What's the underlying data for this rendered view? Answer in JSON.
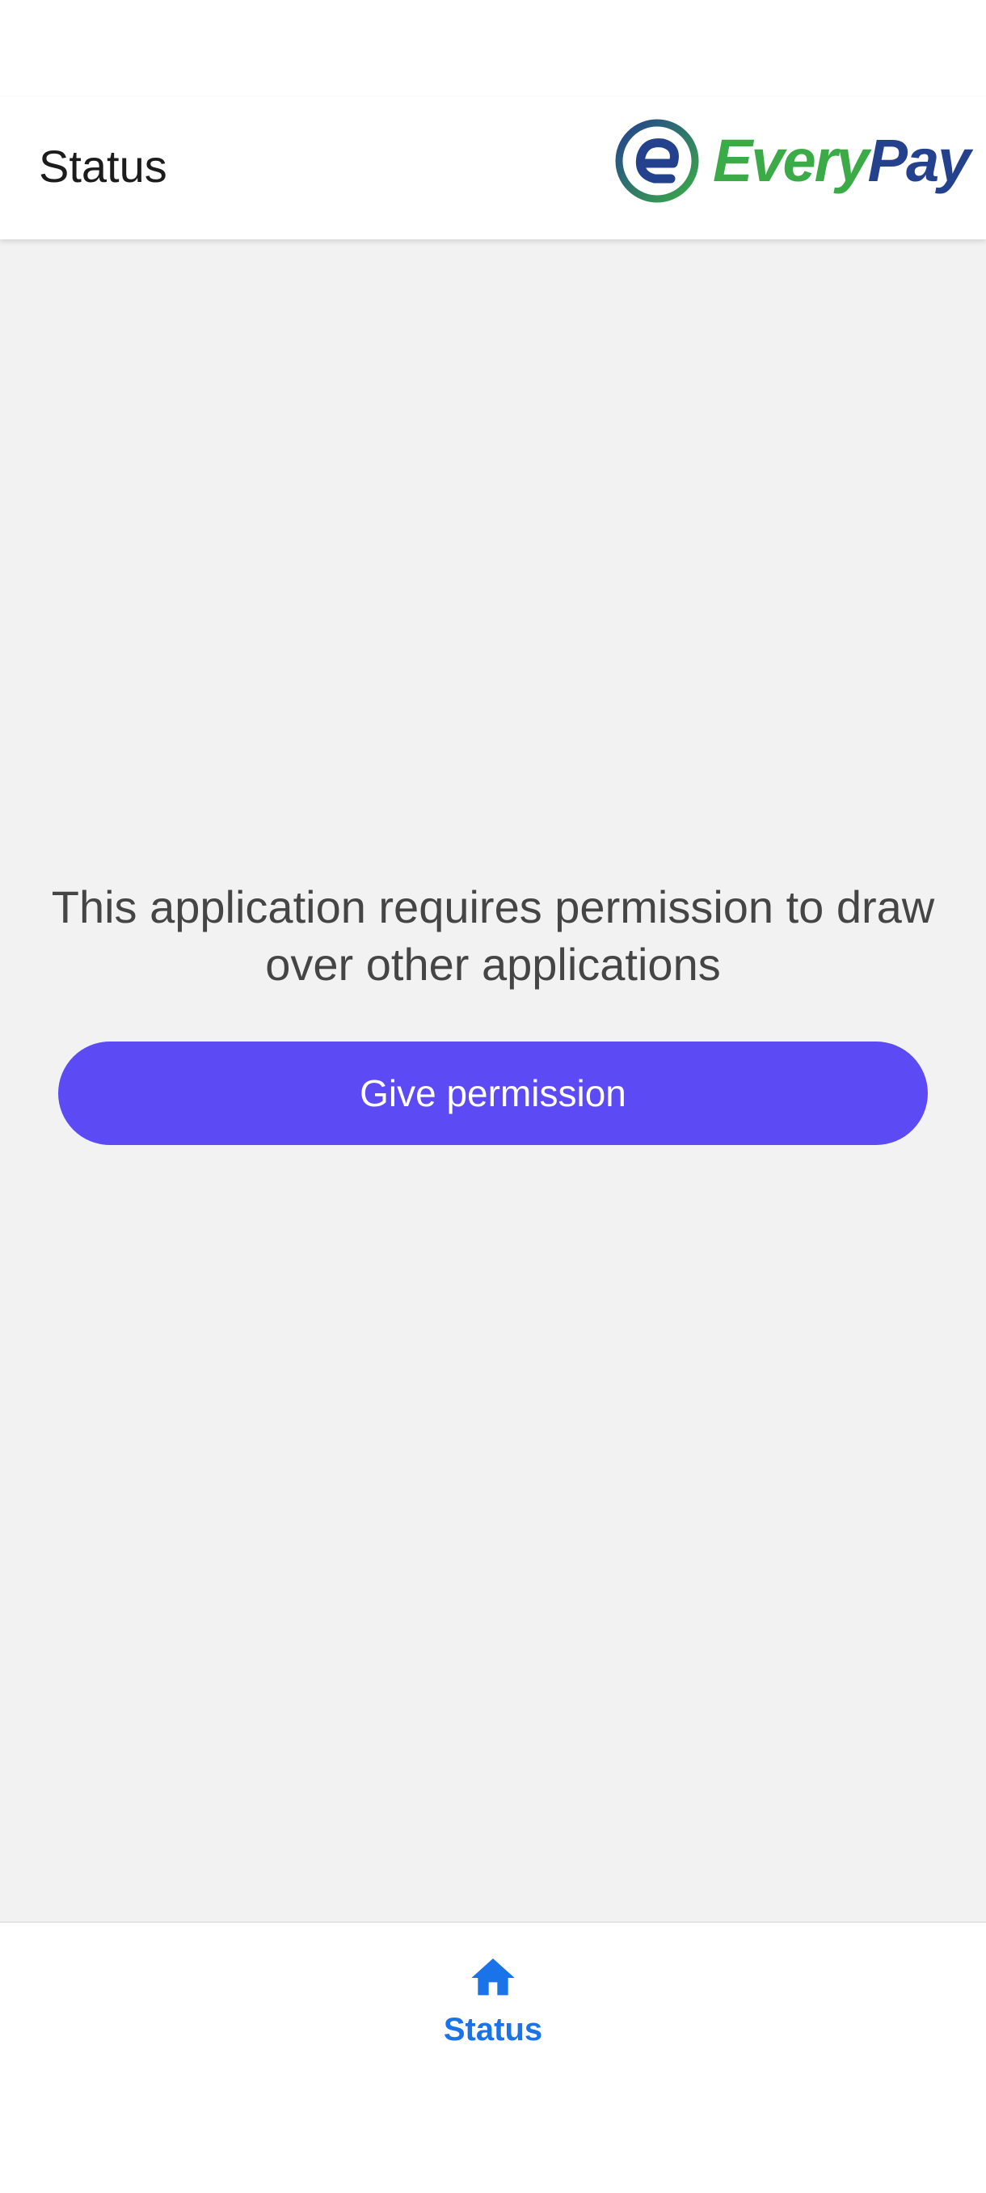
{
  "app_bar": {
    "title": "Status",
    "logo": {
      "word_every": "Every",
      "word_pay": "Pay",
      "mark_letter": "e"
    }
  },
  "main": {
    "message": "This application requires permission to draw over other applications",
    "permission_button_label": "Give permission"
  },
  "bottom_nav": {
    "items": [
      {
        "label": "Status",
        "icon": "home-icon",
        "active": true
      }
    ]
  },
  "colors": {
    "accent_button": "#5c4bf5",
    "nav_active": "#1a73e8",
    "logo_green": "#3bab48",
    "logo_blue": "#24418e",
    "background": "#f2f2f3"
  }
}
